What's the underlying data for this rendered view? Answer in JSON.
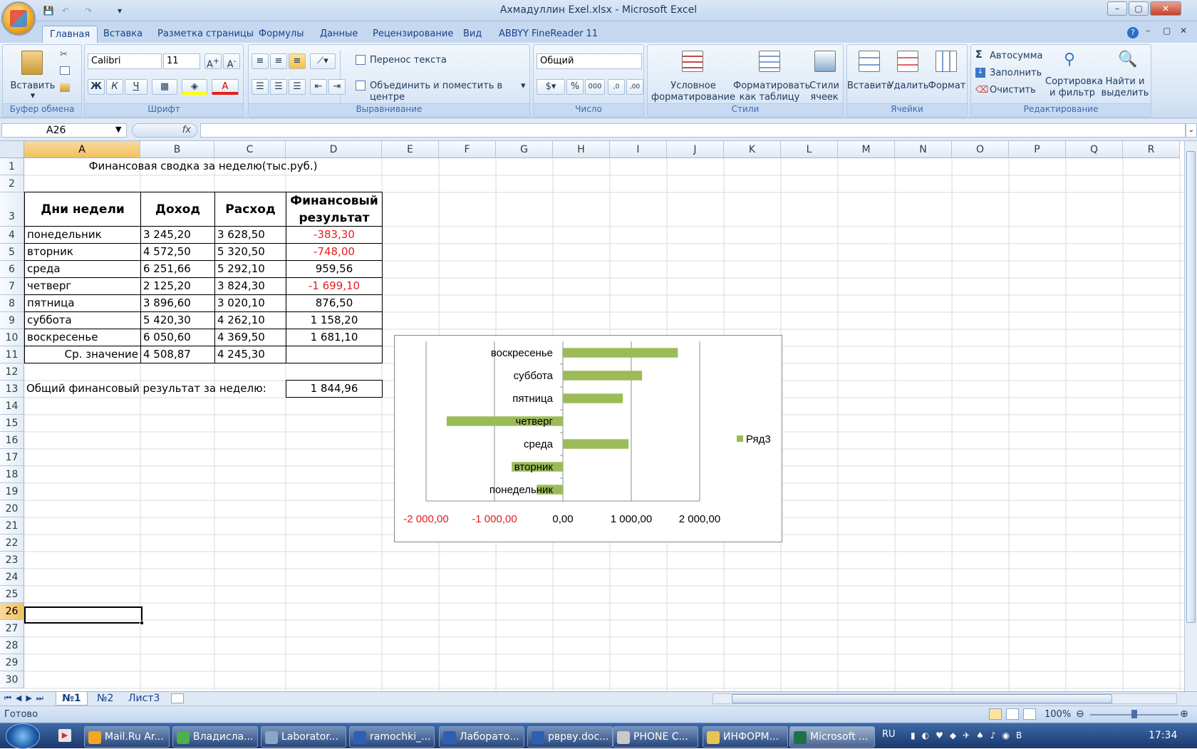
{
  "window": {
    "title": "Ахмадуллин Exel.xlsx - Microsoft Excel"
  },
  "tabs": [
    "Главная",
    "Вставка",
    "Разметка страницы",
    "Формулы",
    "Данные",
    "Рецензирование",
    "Вид",
    "ABBYY FineReader 11"
  ],
  "ribbon": {
    "clipboard": {
      "label": "Буфер обмена",
      "paste": "Вставить"
    },
    "font": {
      "label": "Шрифт",
      "name": "Calibri",
      "size": "11",
      "bold": "Ж",
      "italic": "К",
      "underline": "Ч"
    },
    "align": {
      "label": "Выравнивание",
      "wrap": "Перенос текста",
      "merge": "Объединить и поместить в центре"
    },
    "number": {
      "label": "Число",
      "format": "Общий"
    },
    "styles": {
      "label": "Стили",
      "cond": "Условное",
      "cond2": "форматирование",
      "table": "Форматировать",
      "table2": "как таблицу",
      "cell": "Стили",
      "cell2": "ячеек"
    },
    "cells": {
      "label": "Ячейки",
      "insert": "Вставить",
      "delete": "Удалить",
      "format": "Формат"
    },
    "edit": {
      "label": "Редактирование",
      "autosum": "Автосумма",
      "fill": "Заполнить",
      "clear": "Очистить",
      "sort": "Сортировка",
      "sort2": "и фильтр",
      "find": "Найти и",
      "find2": "выделить"
    }
  },
  "formula": {
    "namebox": "A26",
    "fx": "fx",
    "value": ""
  },
  "columns": [
    "A",
    "B",
    "C",
    "D",
    "E",
    "F",
    "G",
    "H",
    "I",
    "J",
    "K",
    "L",
    "M",
    "N",
    "O",
    "P",
    "Q",
    "R"
  ],
  "rows": [
    "1",
    "2",
    "3",
    "4",
    "5",
    "6",
    "7",
    "8",
    "9",
    "10",
    "11",
    "12",
    "13",
    "14",
    "15",
    "16",
    "17",
    "18",
    "19",
    "20",
    "21",
    "22",
    "23",
    "24",
    "25",
    "26",
    "27",
    "28",
    "29",
    "30"
  ],
  "table": {
    "title": "Финансовая сводка за неделю(тыс.руб.)",
    "headers": [
      "Дни недели",
      "Доход",
      "Расход",
      "Финансовый",
      "результат"
    ],
    "data": [
      [
        "понедельник",
        "3 245,20",
        "3 628,50",
        "-383,30"
      ],
      [
        "вторник",
        "4 572,50",
        "5 320,50",
        "-748,00"
      ],
      [
        "среда",
        "6 251,66",
        "5 292,10",
        "959,56"
      ],
      [
        "четверг",
        "2 125,20",
        "3 824,30",
        "-1 699,10"
      ],
      [
        "пятница",
        "3 896,60",
        "3 020,10",
        "876,50"
      ],
      [
        "суббота",
        "5 420,30",
        "4 262,10",
        "1 158,20"
      ],
      [
        "воскресенье",
        "6 050,60",
        "4 369,50",
        "1 681,10"
      ]
    ],
    "avg": [
      "Ср. значение",
      "4 508,87",
      "4 245,30"
    ],
    "total_label": "Общий финансовый результат за неделю:",
    "total": "1 844,96"
  },
  "chart_data": {
    "type": "bar",
    "orientation": "horizontal",
    "categories": [
      "понедельник",
      "вторник",
      "среда",
      "четверг",
      "пятница",
      "суббота",
      "воскресенье"
    ],
    "series": [
      {
        "name": "Ряд3",
        "values": [
          -383.3,
          -748,
          959.56,
          -1699.1,
          876.5,
          1158.2,
          1681.1
        ]
      }
    ],
    "xlim": [
      -2000,
      2000
    ],
    "xticks": [
      "-2 000,00",
      "-1 000,00",
      "0,00",
      "1 000,00",
      "2 000,00"
    ],
    "negative_tick_color": "#e81c1c",
    "bar_color": "#9bbb59",
    "legend": "right"
  },
  "sheets": [
    "№1",
    "№2",
    "Лист3"
  ],
  "status": {
    "ready": "Готово",
    "zoom": "100%"
  },
  "taskbar": {
    "items": [
      "Mail.Ru Ar...",
      "Владисла...",
      "Laborator...",
      "ramochki_...",
      "Лаборато...",
      "рврву.doc...",
      "PHONE C...",
      "ИНФОРМ...",
      "Microsoft ..."
    ],
    "lang": "RU",
    "time": "17:34"
  }
}
